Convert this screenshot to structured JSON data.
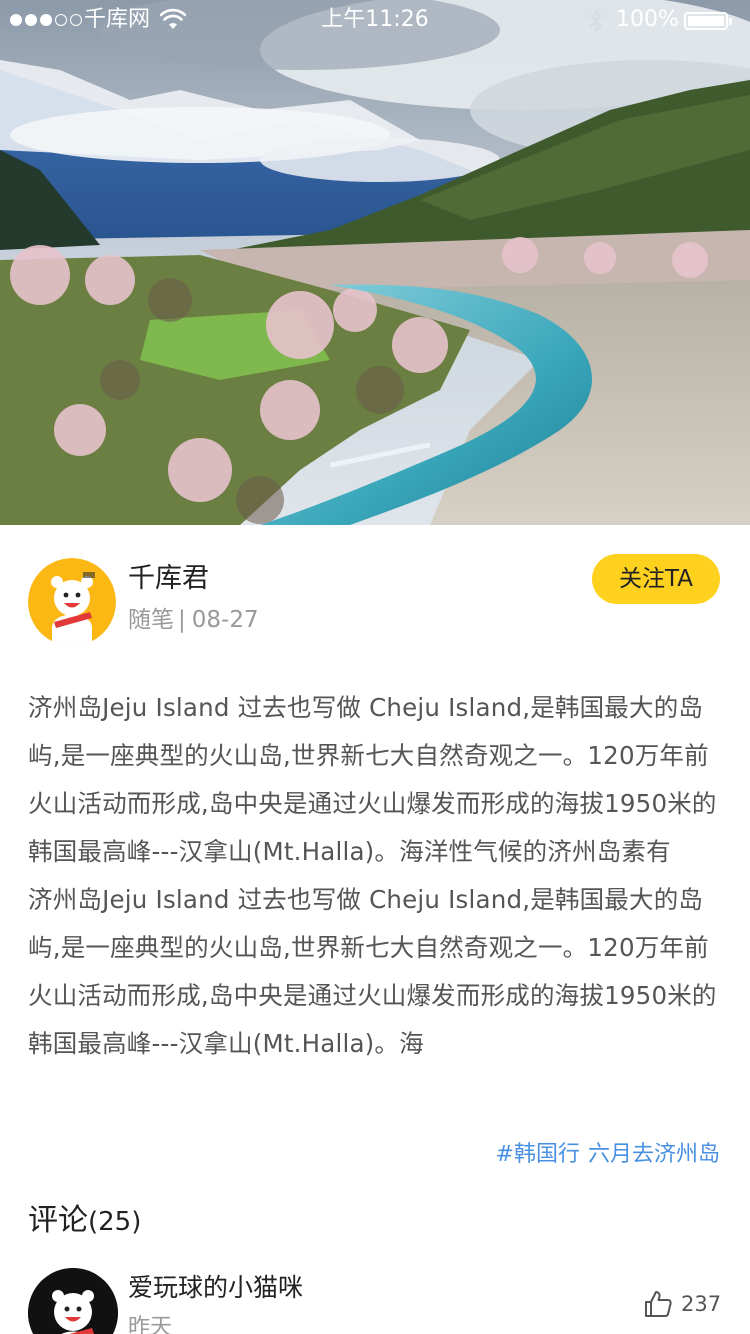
{
  "status_bar": {
    "carrier": "千库网",
    "time": "上午11:26",
    "battery": "100%"
  },
  "hero": {
    "image": "landscape-photo"
  },
  "author": {
    "name": "千库君",
    "category": "随笔",
    "separator": "|",
    "date": "08-27",
    "follow_label": "关注TA"
  },
  "article": {
    "paragraphs": [
      "济州岛Jeju Island 过去也写做 Cheju Island,是韩国最大的岛屿,是一座典型的火山岛,世界新七大自然奇观之一。120万年前火山活动而形成,岛中央是通过火山爆发而形成的海拔1950米的韩国最高峰---汉拿山(Mt.Halla)。海洋性气候的济州岛素有",
      "济州岛Jeju Island 过去也写做 Cheju Island,是韩国最大的岛屿,是一座典型的火山岛,世界新七大自然奇观之一。120万年前火山活动而形成,岛中央是通过火山爆发而形成的海拔1950米的韩国最高峰---汉拿山(Mt.Halla)。海"
    ]
  },
  "tags": [
    "#韩国行",
    "六月去济州岛"
  ],
  "comments": {
    "title": "评论",
    "count": "(25)",
    "items": [
      {
        "user": "爱玩球的小猫咪",
        "time": "昨天",
        "likes": "237"
      }
    ]
  },
  "colors": {
    "accent": "#ffd11f",
    "tag": "#4a90e2",
    "meta": "#999999"
  }
}
